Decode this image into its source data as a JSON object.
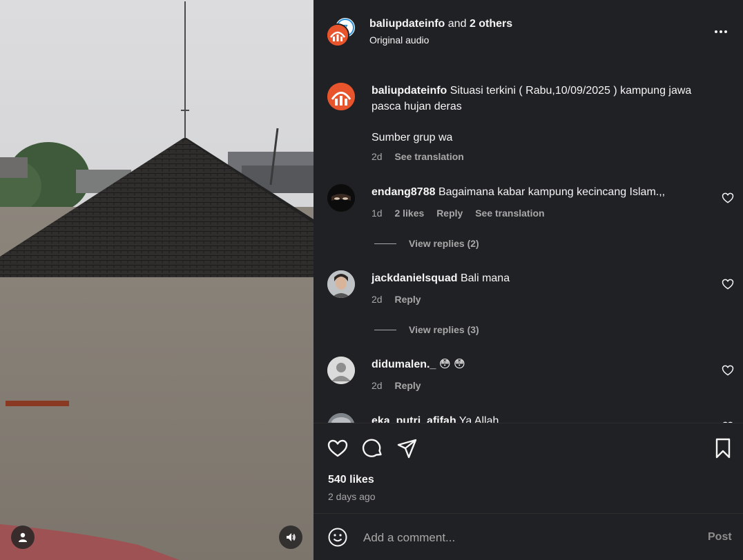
{
  "header": {
    "username": "baliupdateinfo",
    "joiner": "and",
    "others": "2 others",
    "audio": "Original audio",
    "more_icon": "more-horizontal-icon"
  },
  "caption": {
    "username": "baliupdateinfo",
    "text_line1": "Situasi terkini ( Rabu,10/09/2025 ) kampung jawa pasca hujan deras",
    "text_line2": "Sumber grup wa",
    "time": "2d",
    "translate": "See translation"
  },
  "comments": [
    {
      "username": "endang8788",
      "text": "Bagaimana kabar kampung kecincang Islam.,,",
      "time": "1d",
      "likes": "2 likes",
      "reply": "Reply",
      "translate": "See translation",
      "view_replies": "View replies (2)"
    },
    {
      "username": "jackdanielsquad",
      "text": "Bali mana",
      "time": "2d",
      "reply": "Reply",
      "view_replies": "View replies (3)"
    },
    {
      "username": "didumalen._",
      "text": "😳 😳",
      "time": "2d",
      "reply": "Reply"
    },
    {
      "username": "eka_putri_afifah",
      "text": "Ya Allah"
    }
  ],
  "post": {
    "likes": "540 likes",
    "time": "2 days ago"
  },
  "comment_box": {
    "placeholder": "Add a comment...",
    "post_label": "Post"
  },
  "colors": {
    "panel_bg": "#202124",
    "text": "#f5f5f5",
    "muted": "#a8a8a8",
    "brand": "#e8542b"
  }
}
